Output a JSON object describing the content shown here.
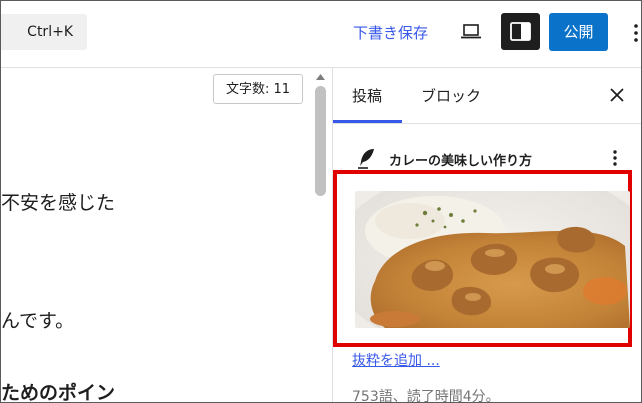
{
  "toolbar": {
    "command_shortcut": "Ctrl+K",
    "save_draft_label": "下書き保存",
    "publish_label": "公開",
    "icons": [
      "laptop-icon",
      "sidebar-toggle-icon",
      "more-vertical-icon"
    ],
    "accent_color": "#3858e9",
    "publish_color": "#0a72c8"
  },
  "editor": {
    "word_count": "文字数: 11",
    "lines": [
      "不安を感じた",
      "んです。"
    ],
    "heading": "ためのポイン"
  },
  "sidebar": {
    "tabs": [
      {
        "label": "投稿",
        "active": true
      },
      {
        "label": "ブロック",
        "active": false
      }
    ],
    "post_title": "カレーの美味しい作り方",
    "excerpt_link": "抜粋を追加 ...",
    "stats": "753語、読了時間4分。",
    "highlight_color": "#e00000"
  }
}
